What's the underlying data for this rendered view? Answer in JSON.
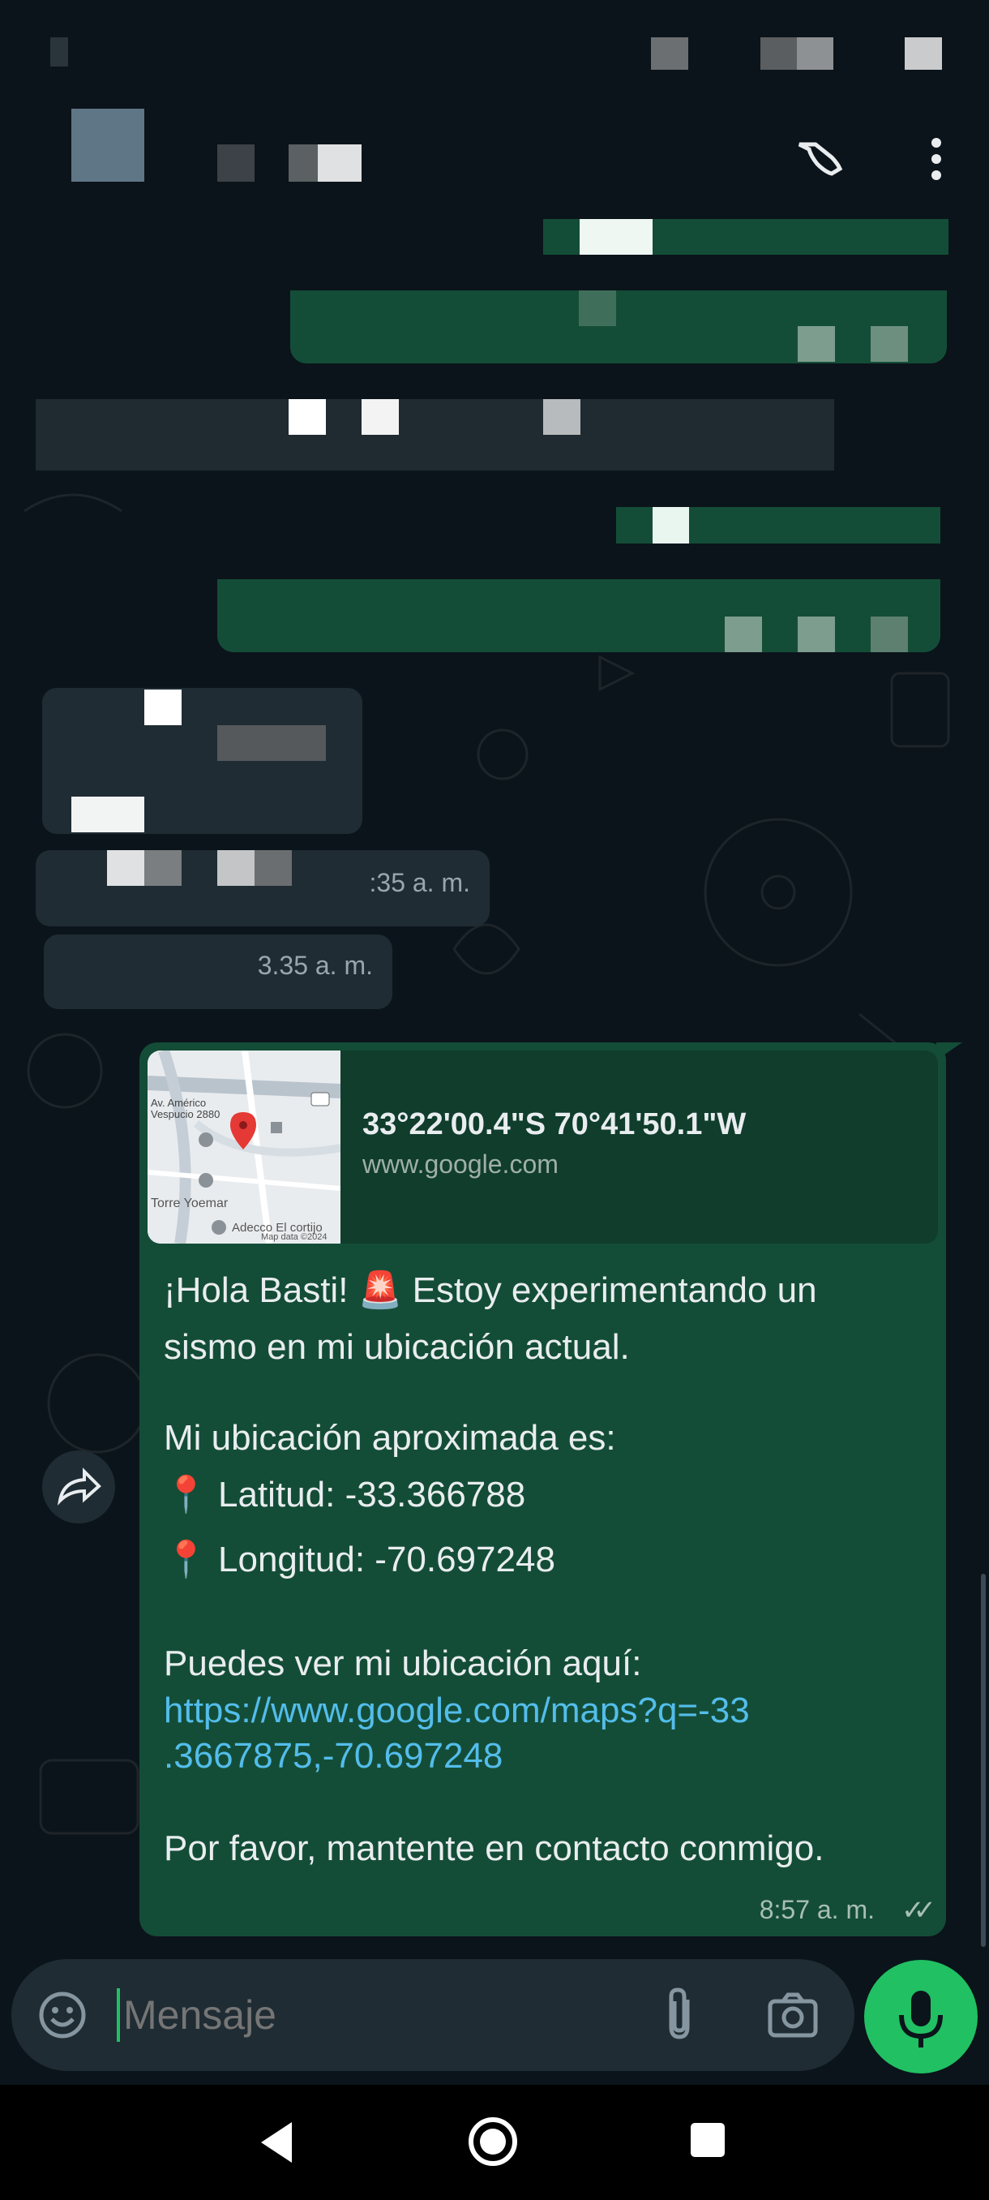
{
  "colors": {
    "app_bg": "#0b141a",
    "outgoing_bubble": "#144d37",
    "incoming_bubble": "#1f2c33",
    "link": "#53bdeb",
    "accent_green": "#21c063",
    "text": "#e9edef",
    "meta_text": "#a8bfb6"
  },
  "statusbar": {
    "icons": [
      "network-icon",
      "wifi-icon",
      "battery-icon"
    ]
  },
  "header": {
    "icons": [
      "avatar",
      "voice-call-icon",
      "more-options-icon"
    ]
  },
  "incoming": [
    {
      "time": ":35 a. m."
    },
    {
      "time": "3.35 a. m."
    }
  ],
  "outgoing_location_message": {
    "preview": {
      "title": "33°22'00.4\"S 70°41'50.1\"W",
      "domain": "www.google.com",
      "map_labels": [
        "Av. Américo Vespucio 2880",
        "Torre Yoemar",
        "Adecco El cortijo",
        "Map data ©2024"
      ]
    },
    "lines": {
      "l1": "¡Hola Basti! 🚨 Estoy experimentando un",
      "l2": "sismo en mi ubicación actual.",
      "l3": "Mi ubicación aproximada es:",
      "l4": "📍 Latitud: -33.366788",
      "l5": "📍 Longitud: -70.697248",
      "l6": "Puedes ver mi ubicación aquí:",
      "link1": "https://www.google.com/maps?q=-33",
      "link2": ".3667875,-70.697248",
      "l7": "Por favor, mantente en contacto conmigo."
    },
    "time": "8:57 a. m.",
    "ticks": "✓✓"
  },
  "input": {
    "placeholder": "Mensaje"
  },
  "icons": {
    "forward": "forward-icon",
    "emoji": "emoji-icon",
    "attach": "attach-icon",
    "camera": "camera-icon",
    "mic": "mic-icon",
    "back": "back-icon",
    "home": "home-icon",
    "recents": "recents-icon"
  }
}
